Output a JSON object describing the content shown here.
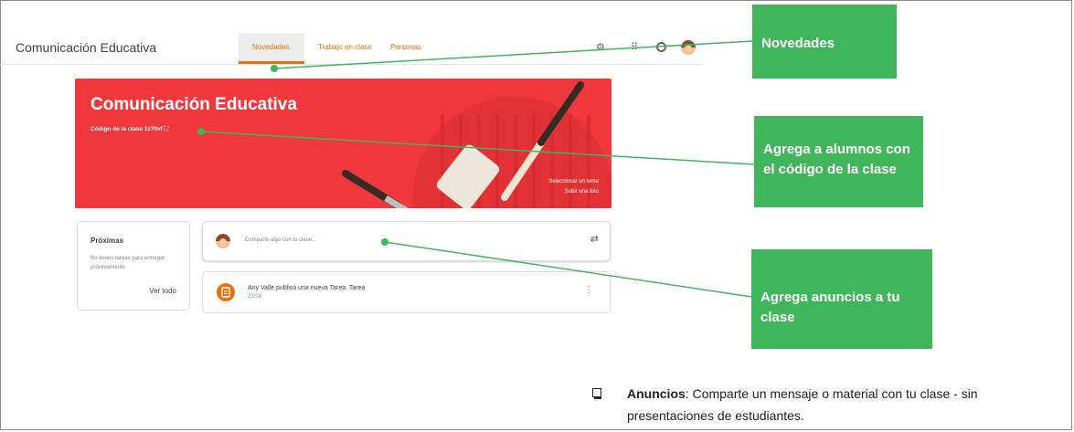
{
  "classroom": {
    "course_title": "Comunicación Educativa",
    "tabs": [
      {
        "label": "Novedades",
        "active": true
      },
      {
        "label": "Trabajo en clase",
        "active": false
      },
      {
        "label": "Personas",
        "active": false
      }
    ],
    "header_icons": [
      "settings-icon",
      "apps-grid-icon",
      "account-circle-icon",
      "user-avatar"
    ]
  },
  "banner": {
    "title": "Comunicación Educativa",
    "code_label": "Código de la clase",
    "code_value": "1z70vf",
    "select_theme": "Seleccionar un tema",
    "upload_photo": "Subir una foto"
  },
  "upcoming": {
    "title": "Próximas",
    "empty_text": "No tienes tareas para entregar próximamente",
    "view_all": "Ver todo"
  },
  "share": {
    "placeholder": "Comparte algo con tu clase..."
  },
  "post": {
    "text": "Any Valle publicó una nueva Tarea: Tarea",
    "time": "23:04"
  },
  "callouts": {
    "novedades": "Novedades",
    "codigo": "Agrega a alumnos con el código de la clase",
    "anuncios": "Agrega anuncios a tu clase"
  },
  "note": {
    "bold": "Anuncios",
    "text": ": Comparte un mensaje o material con tu clase - sin presentaciones de estudiantes."
  },
  "colors": {
    "banner": "#f0383c",
    "accent": "#e8710a",
    "callout": "#3fb65a"
  }
}
